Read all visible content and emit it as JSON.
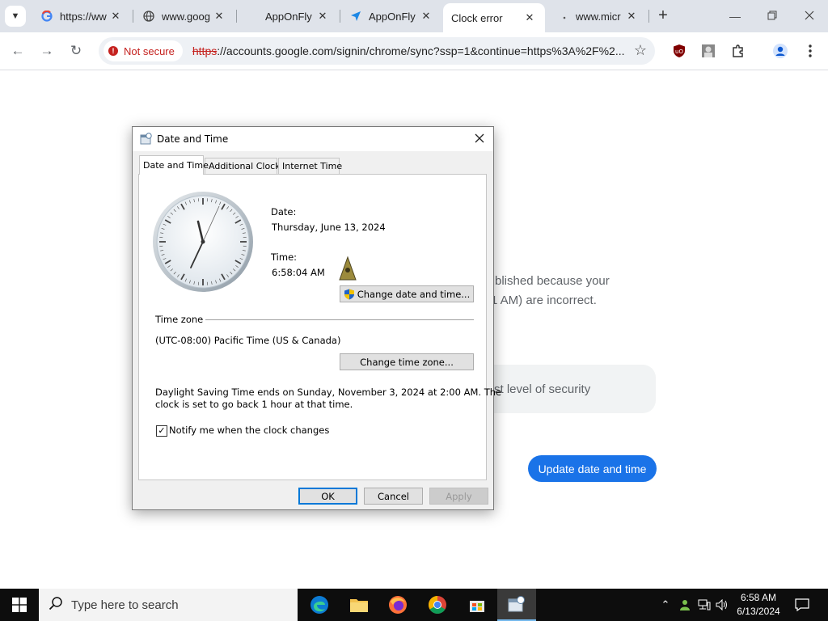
{
  "browser": {
    "tabs": [
      {
        "title": "https://ww",
        "favicon": "google-g-icon",
        "active": false
      },
      {
        "title": "www.goog",
        "favicon": "globe-icon",
        "active": false
      },
      {
        "title": "AppOnFly",
        "favicon": "blank-icon",
        "active": false
      },
      {
        "title": "AppOnFly",
        "favicon": "paper-plane-icon",
        "active": false
      },
      {
        "title": "Clock error",
        "favicon": "none",
        "active": true
      },
      {
        "title": "www.micr",
        "favicon": "dot-icon",
        "active": false
      }
    ],
    "close_glyph": "✕",
    "new_tab_glyph": "+",
    "security_chip": "Not secure",
    "url_protocol": "https",
    "url_rest": "://accounts.google.com/signin/chrome/sync?ssp=1&continue=https%3A%2F%2..."
  },
  "background_page": {
    "line1": "blished because your",
    "line2": "1 AM) are incorrect.",
    "security_text": "st level of security",
    "update_button": "Update date and time"
  },
  "dialog": {
    "title": "Date and Time",
    "tabs": [
      "Date and Time",
      "Additional Clocks",
      "Internet Time"
    ],
    "date_label": "Date:",
    "date_value": "Thursday, June 13, 2024",
    "time_label": "Time:",
    "time_value": "6:58:04 AM",
    "change_datetime_button": "Change date and time...",
    "timezone_heading": "Time zone",
    "timezone_value": "(UTC-08:00) Pacific Time (US & Canada)",
    "change_timezone_button": "Change time zone...",
    "dst_line1": "Daylight Saving Time ends on Sunday, November 3, 2024 at 2:00 AM. The",
    "dst_line2": "clock is set to go back 1 hour at that time.",
    "notify_label": "Notify me when the clock changes",
    "notify_checked": true,
    "ok_button": "OK",
    "cancel_button": "Cancel",
    "apply_button": "Apply"
  },
  "taskbar": {
    "search_placeholder": "Type here to search",
    "time": "6:58 AM",
    "date": "6/13/2024"
  },
  "colors": {
    "chrome_accent": "#1a73e8",
    "not_secure_red": "#c5221f",
    "taskbar_bg": "#0d0d0d"
  }
}
